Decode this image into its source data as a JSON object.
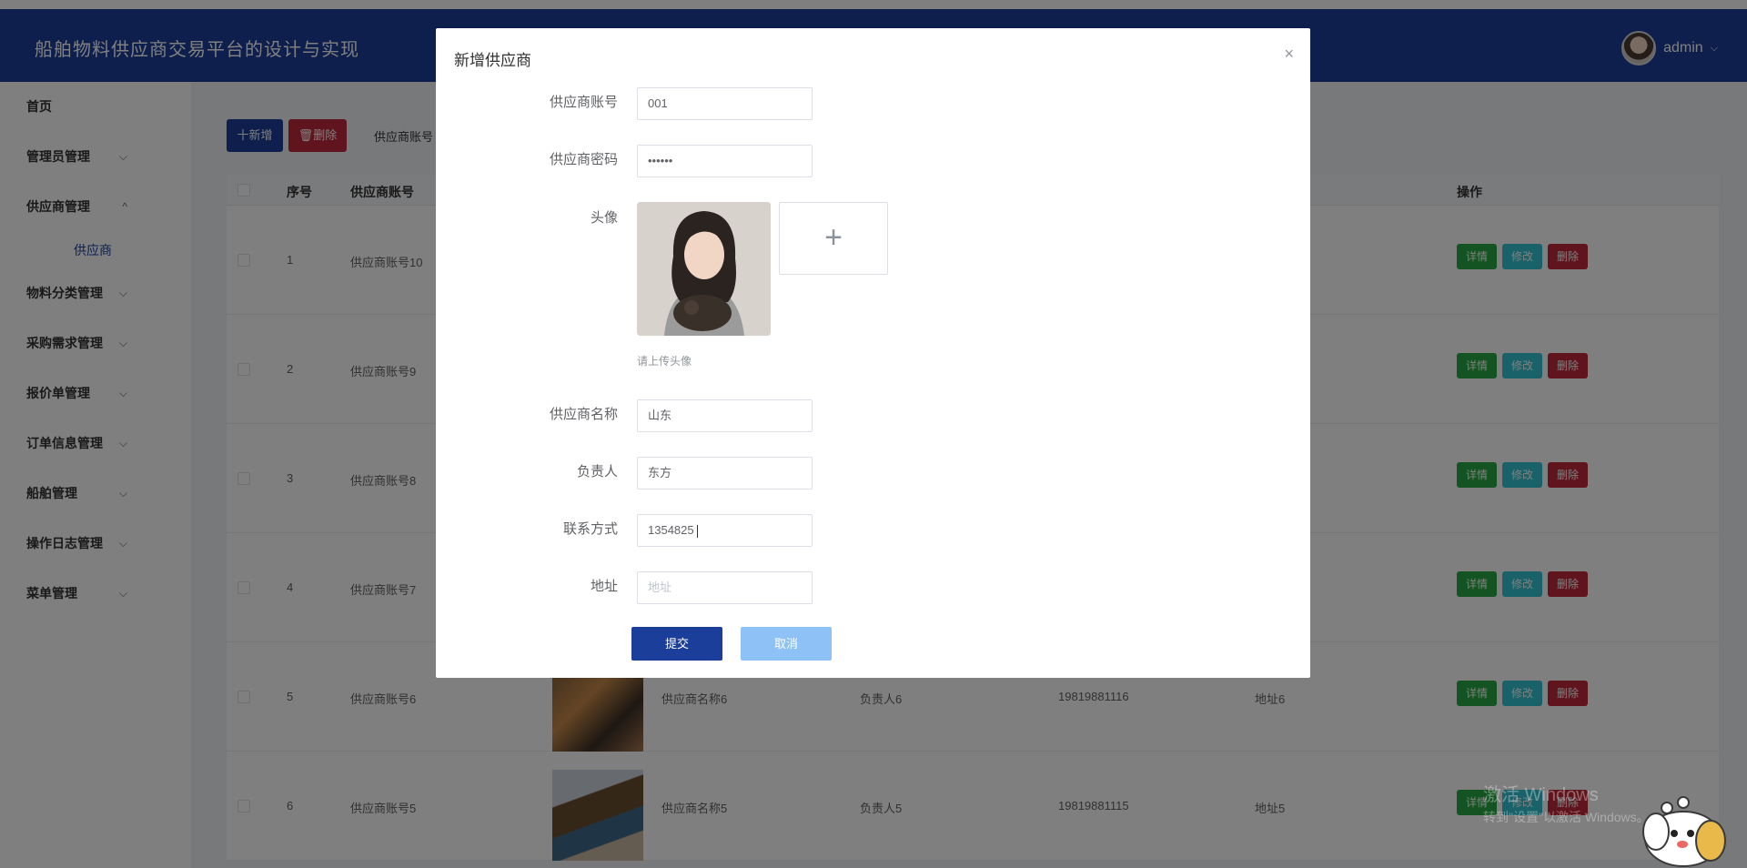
{
  "header": {
    "title": "船舶物料供应商交易平台的设计与实现",
    "user": "admin",
    "caret": "⌵"
  },
  "sidebar": {
    "home": "首页",
    "items": [
      {
        "label": "管理员管理",
        "chev": "⌵"
      },
      {
        "label": "供应商管理",
        "chev": "^"
      },
      {
        "label": "物料分类管理",
        "chev": "⌵"
      },
      {
        "label": "采购需求管理",
        "chev": "⌵"
      },
      {
        "label": "报价单管理",
        "chev": "⌵"
      },
      {
        "label": "订单信息管理",
        "chev": "⌵"
      },
      {
        "label": "船舶管理",
        "chev": "⌵"
      },
      {
        "label": "操作日志管理",
        "chev": "⌵"
      },
      {
        "label": "菜单管理",
        "chev": "⌵"
      }
    ],
    "sub_supplier": "供应商"
  },
  "toolbar": {
    "add": "十新增",
    "delete": "🗑删除",
    "search_label": "供应商账号"
  },
  "table": {
    "headers": {
      "index": "序号",
      "account": "供应商账号",
      "ops": "操作"
    },
    "rows": [
      {
        "index": "1",
        "account": "供应商账号10",
        "name": "",
        "person": "",
        "phone": "",
        "addr": ""
      },
      {
        "index": "2",
        "account": "供应商账号9",
        "name": "",
        "person": "",
        "phone": "",
        "addr": ""
      },
      {
        "index": "3",
        "account": "供应商账号8",
        "name": "",
        "person": "",
        "phone": "",
        "addr": ""
      },
      {
        "index": "4",
        "account": "供应商账号7",
        "name": "",
        "person": "",
        "phone": "",
        "addr": ""
      },
      {
        "index": "5",
        "account": "供应商账号6",
        "name": "供应商名称6",
        "person": "负责人6",
        "phone": "19819881116",
        "addr": "地址6"
      },
      {
        "index": "6",
        "account": "供应商账号5",
        "name": "供应商名称5",
        "person": "负责人5",
        "phone": "19819881115",
        "addr": "地址5"
      }
    ],
    "op_detail": "详情",
    "op_edit": "修改",
    "op_delete": "删除"
  },
  "dialog": {
    "title": "新增供应商",
    "close": "×",
    "fields": {
      "account": {
        "label": "供应商账号",
        "value": "001"
      },
      "password": {
        "label": "供应商密码",
        "value": "••••••"
      },
      "avatar": {
        "label": "头像",
        "hint": "请上传头像",
        "plus": "+"
      },
      "name": {
        "label": "供应商名称",
        "value": "山东"
      },
      "person": {
        "label": "负责人",
        "value": "东方"
      },
      "phone": {
        "label": "联系方式",
        "value": "1354825"
      },
      "address": {
        "label": "地址",
        "placeholder": "地址"
      }
    },
    "submit": "提交",
    "cancel": "取消"
  },
  "watermark": {
    "line1": "激活 Windows",
    "line2": "转到\"设置\"以激活 Windows。"
  }
}
